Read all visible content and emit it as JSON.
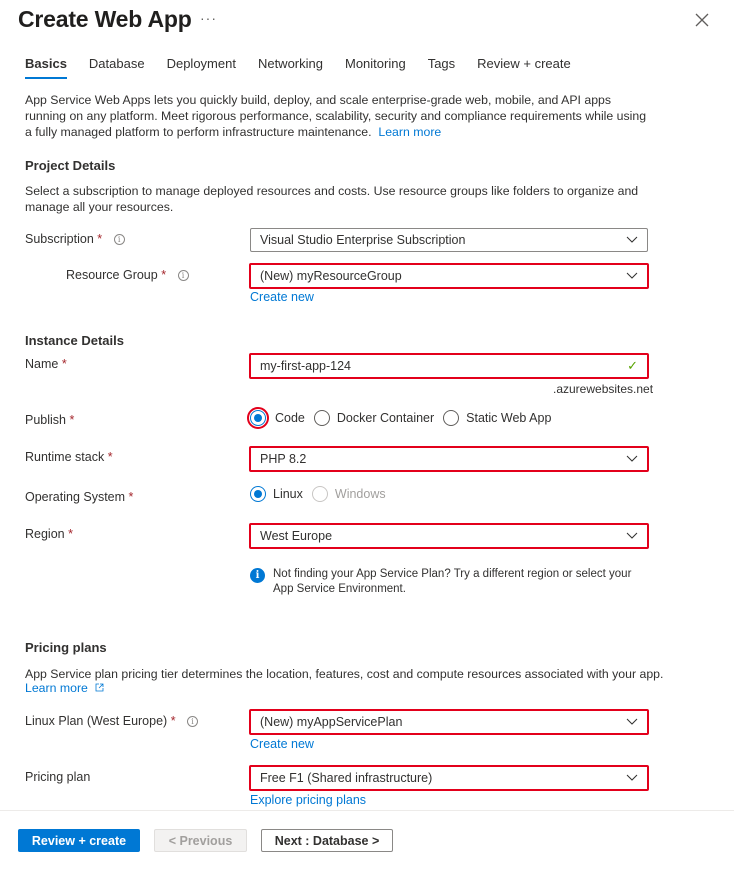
{
  "header": {
    "title": "Create Web App",
    "more_label": "···",
    "close_icon": "close-icon"
  },
  "tabs": [
    {
      "label": "Basics",
      "active": true
    },
    {
      "label": "Database",
      "active": false
    },
    {
      "label": "Deployment",
      "active": false
    },
    {
      "label": "Networking",
      "active": false
    },
    {
      "label": "Monitoring",
      "active": false
    },
    {
      "label": "Tags",
      "active": false
    },
    {
      "label": "Review + create",
      "active": false
    }
  ],
  "intro": {
    "text": "App Service Web Apps lets you quickly build, deploy, and scale enterprise-grade web, mobile, and API apps running on any platform. Meet rigorous performance, scalability, security and compliance requirements while using a fully managed platform to perform infrastructure maintenance.",
    "link": "Learn more"
  },
  "project": {
    "heading": "Project Details",
    "description": "Select a subscription to manage deployed resources and costs. Use resource groups like folders to organize and manage all your resources.",
    "subscription": {
      "label": "Subscription",
      "required": "*",
      "value": "Visual Studio Enterprise Subscription"
    },
    "resource_group": {
      "label": "Resource Group",
      "required": "*",
      "value": "(New) myResourceGroup",
      "create_new": "Create new"
    }
  },
  "instance": {
    "heading": "Instance Details",
    "name": {
      "label": "Name",
      "required": "*",
      "value": "my-first-app-124",
      "suffix": ".azurewebsites.net",
      "valid_icon": "✓"
    },
    "publish": {
      "label": "Publish",
      "required": "*",
      "options": [
        "Code",
        "Docker Container",
        "Static Web App"
      ],
      "selected": "Code"
    },
    "runtime": {
      "label": "Runtime stack",
      "required": "*",
      "value": "PHP 8.2"
    },
    "os": {
      "label": "Operating System",
      "required": "*",
      "options": [
        "Linux",
        "Windows"
      ],
      "selected": "Linux",
      "disabled": [
        "Windows"
      ]
    },
    "region": {
      "label": "Region",
      "required": "*",
      "value": "West Europe"
    },
    "info": "Not finding your App Service Plan? Try a different region or select your App Service Environment."
  },
  "pricing": {
    "heading": "Pricing plans",
    "description": "App Service plan pricing tier determines the location, features, cost and compute resources associated with your app.",
    "learn_more": "Learn more",
    "plan": {
      "label": "Linux Plan (West Europe)",
      "required": "*",
      "value": "(New) myAppServicePlan",
      "create_new": "Create new"
    },
    "pricing_plan": {
      "label": "Pricing plan",
      "value": "Free F1 (Shared infrastructure)",
      "explore": "Explore pricing plans"
    }
  },
  "footer": {
    "review_create": "Review + create",
    "previous": "< Previous",
    "next": "Next : Database >"
  },
  "colors": {
    "accent": "#0078d4",
    "highlight_border": "#e3001b",
    "required": "#a4262c",
    "valid": "#57a300"
  }
}
